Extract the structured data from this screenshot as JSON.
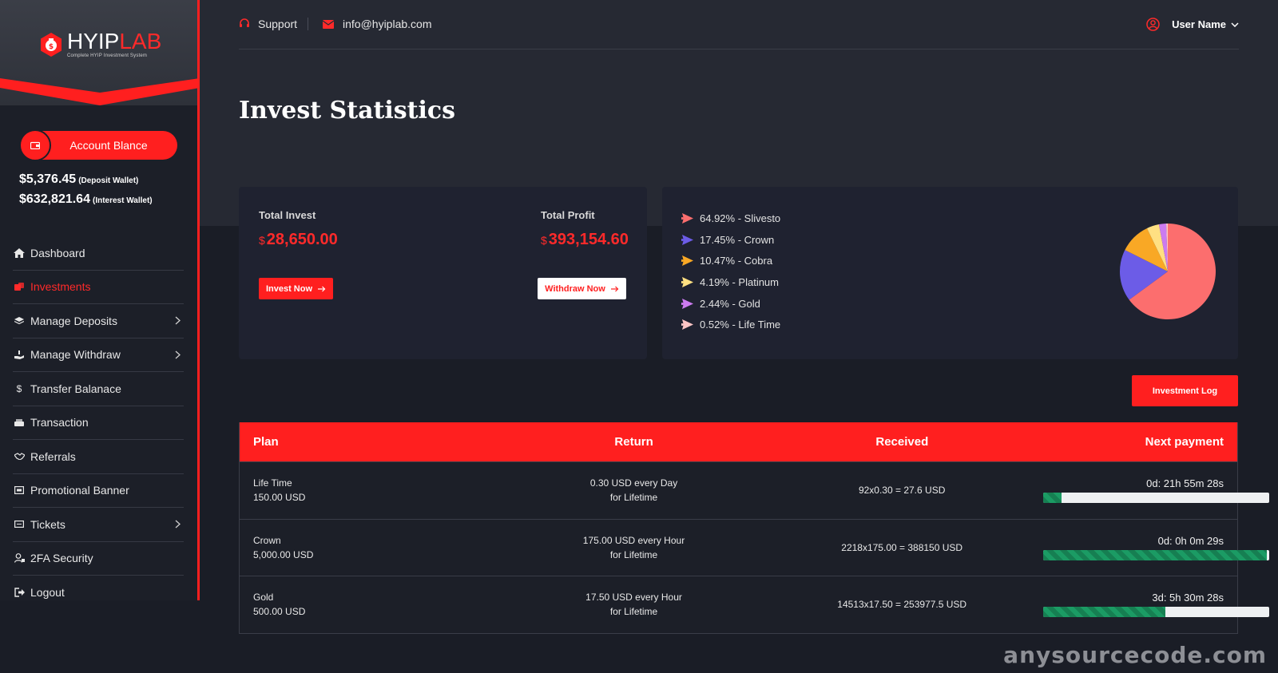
{
  "brand": {
    "name_main": "HYIP",
    "name_accent": "LAB",
    "tagline": "Complete HYIP Investment System"
  },
  "sidebar": {
    "balance_label": "Account Blance",
    "wallets": [
      {
        "amount": "$5,376.45",
        "label": "(Deposit Wallet)"
      },
      {
        "amount": "$632,821.64",
        "label": "(Interest Wallet)"
      }
    ],
    "items": [
      {
        "label": "Dashboard",
        "icon": "home-icon",
        "active": false,
        "has_children": false
      },
      {
        "label": "Investments",
        "icon": "coins-icon",
        "active": true,
        "has_children": false
      },
      {
        "label": "Manage Deposits",
        "icon": "layers-icon",
        "active": false,
        "has_children": true
      },
      {
        "label": "Manage Withdraw",
        "icon": "hand-money-icon",
        "active": false,
        "has_children": true
      },
      {
        "label": "Transfer Balanace",
        "icon": "dollar-icon",
        "active": false,
        "has_children": false
      },
      {
        "label": "Transaction",
        "icon": "cash-icon",
        "active": false,
        "has_children": false
      },
      {
        "label": "Referrals",
        "icon": "handshake-icon",
        "active": false,
        "has_children": false
      },
      {
        "label": "Promotional Banner",
        "icon": "image-icon",
        "active": false,
        "has_children": false
      },
      {
        "label": "Tickets",
        "icon": "ticket-icon",
        "active": false,
        "has_children": true
      },
      {
        "label": "2FA Security",
        "icon": "user-lock-icon",
        "active": false,
        "has_children": false
      },
      {
        "label": "Logout",
        "icon": "logout-icon",
        "active": false,
        "has_children": false
      }
    ]
  },
  "header": {
    "support_label": "Support",
    "email": "info@hyiplab.com",
    "user_name": "User Name"
  },
  "page": {
    "title": "Invest Statistics"
  },
  "stats": {
    "total_invest_label": "Total Invest",
    "total_invest_currency": "$",
    "total_invest_value": "28,650.00",
    "total_profit_label": "Total Profit",
    "total_profit_currency": "$",
    "total_profit_value": "393,154.60",
    "invest_button": "Invest Now",
    "withdraw_button": "Withdraw Now"
  },
  "chart_data": {
    "type": "pie",
    "slices": [
      {
        "label": "64.92% - Slivesto",
        "name": "Slivesto",
        "value": 64.92,
        "color": "#fc6e6e"
      },
      {
        "label": "17.45% - Crown",
        "name": "Crown",
        "value": 17.45,
        "color": "#6c5ce7"
      },
      {
        "label": "10.47% - Cobra",
        "name": "Cobra",
        "value": 10.47,
        "color": "#f9a825"
      },
      {
        "label": "4.19% - Platinum",
        "name": "Platinum",
        "value": 4.19,
        "color": "#ffe082"
      },
      {
        "label": "2.44% - Gold",
        "name": "Gold",
        "value": 2.44,
        "color": "#cc7bf0"
      },
      {
        "label": "0.52% - Life Time",
        "name": "Life Time",
        "value": 0.52,
        "color": "#ffc6c6"
      }
    ]
  },
  "investment_log_button": "Investment Log",
  "table": {
    "headers": [
      "Plan",
      "Return",
      "Received",
      "Next payment"
    ],
    "rows": [
      {
        "plan": "Life Time",
        "amount": "150.00 USD",
        "return_line1": "0.30 USD every Day",
        "return_line2": "for Lifetime",
        "received": "92x0.30 = 27.6 USD",
        "next": "0d: 21h 55m 28s",
        "progress": 0.08
      },
      {
        "plan": "Crown",
        "amount": "5,000.00 USD",
        "return_line1": "175.00 USD every Hour",
        "return_line2": "for Lifetime",
        "received": "2218x175.00 = 388150 USD",
        "next": "0d: 0h 0m 29s",
        "progress": 0.99
      },
      {
        "plan": "Gold",
        "amount": "500.00 USD",
        "return_line1": "17.50 USD every Hour",
        "return_line2": "for Lifetime",
        "received": "14513x17.50 = 253977.5 USD",
        "next": "3d: 5h 30m 28s",
        "progress": 0.54
      }
    ]
  },
  "watermark": "anysourcecode.com",
  "colors": {
    "accent": "#ff1f1f",
    "background": "#1a1d26",
    "card": "#1f2230",
    "progress": "#1b9b64"
  }
}
